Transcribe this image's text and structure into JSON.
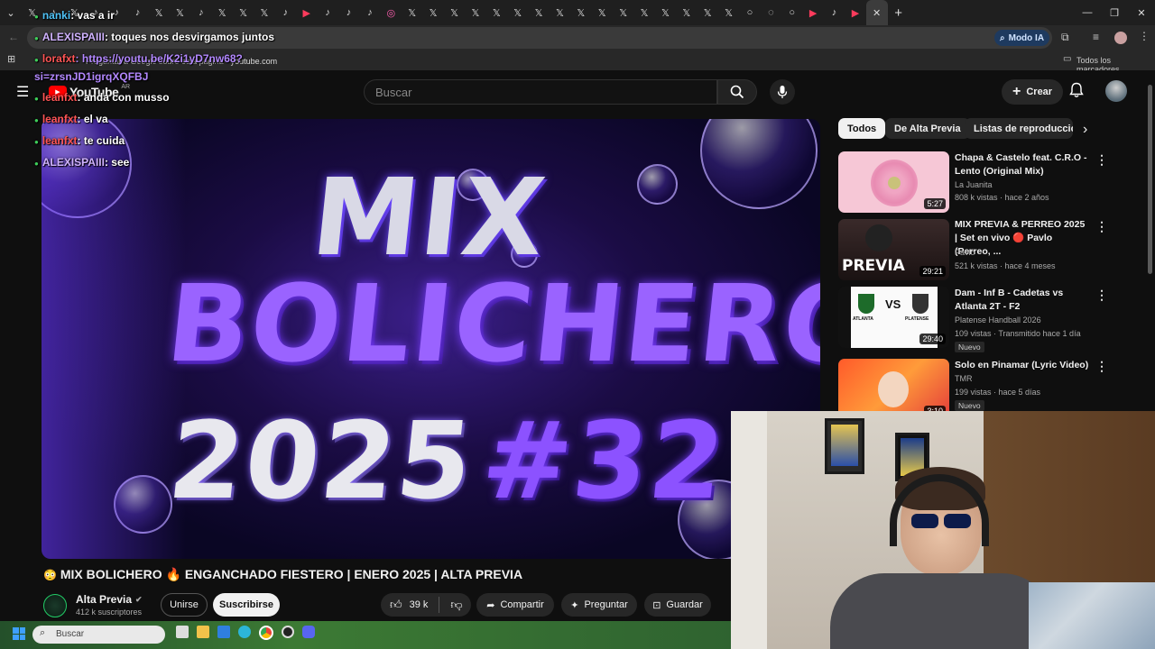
{
  "browser": {
    "tab_icons": [
      "𝕏",
      "♪",
      "𝕏",
      "♪",
      "♪",
      "♪",
      "𝕏",
      "𝕏",
      "♪",
      "𝕏",
      "𝕏",
      "𝕏",
      "♪",
      "▶",
      "♪",
      "♪",
      "♪",
      "◎",
      "𝕏",
      "𝕏",
      "𝕏",
      "𝕏",
      "𝕏",
      "𝕏",
      "𝕏",
      "𝕏",
      "𝕏",
      "𝕏",
      "𝕏",
      "𝕏",
      "𝕏",
      "𝕏",
      "𝕏",
      "𝕏",
      "○",
      "◌",
      "○",
      "▶",
      "♪",
      "▶"
    ],
    "new_tab": "+",
    "suggestion_text": "Preguntar a Google sobre esta página",
    "suggestion_domain": "youtube.com",
    "ai_mode": "Modo IA",
    "bookmarks_folder": "Todos los marcadores"
  },
  "youtube": {
    "logo": "YouTube",
    "logo_country": "AR",
    "search_placeholder": "Buscar",
    "create_label": "Crear",
    "video": {
      "title": "MIX BOLICHERO 🔥 ENGANCHADO FIESTERO | ENERO 2025 | ALTA PREVIA",
      "thumb_line1": "MIX",
      "thumb_line2": "BOLICHERO",
      "thumb_line3a": "2025",
      "thumb_line3b": "#32",
      "channel": "Alta Previa",
      "subscribers": "412 k suscriptores",
      "join": "Unirse",
      "subscribe": "Suscribirse",
      "likes": "39 k",
      "share": "Compartir",
      "ask": "Preguntar",
      "save": "Guardar"
    },
    "chips": [
      "Todos",
      "De Alta Previa",
      "Listas de reproducción"
    ],
    "recommendations": [
      {
        "title": "Chapa & Castelo feat. C.R.O - Lento (Original Mix)",
        "channel": "La Juanita",
        "meta": "808 k vistas · hace 2 años",
        "duration": "5:27",
        "badge": ""
      },
      {
        "title": "MIX PREVIA & PERREO 2025 | Set en vivo 🔴 Pavlo (Perreo, ...",
        "channel": "Pavlo",
        "meta": "521 k vistas · hace 4 meses",
        "duration": "29:21",
        "badge": "",
        "thumb_text": "PREVIA"
      },
      {
        "title": "Dam - Inf B - Cadetas vs Atlanta 2T - F2",
        "channel": "Platense Handball 2026",
        "meta": "109 vistas · Transmitido hace 1 día",
        "duration": "29:40",
        "badge": "Nuevo",
        "thumb_text": "VS",
        "team1": "ATLANTA",
        "team2": "PLATENSE"
      },
      {
        "title": "Solo en Pinamar (Lyric Video)",
        "channel": "TMR",
        "meta": "199 vistas · hace 5 días",
        "duration": "3:10",
        "badge": "Nuevo"
      }
    ]
  },
  "chat": [
    {
      "user": "nanki",
      "text": ": vas a ir",
      "color": "#4fc3f7"
    },
    {
      "user": "ALEXISPAIII",
      "text": ": toques nos desvirgamos juntos",
      "color": "#d0b3ff"
    },
    {
      "user": "lorafxt",
      "text": ": https://youtu.be/K2i1yD7nw68?",
      "color": "#ff5555"
    },
    {
      "user": "",
      "text": "si=zrsnJD1igrqXQFBJ",
      "color": "#b388ff"
    },
    {
      "user": "leanfxt",
      "text": ": anda con musso",
      "color": "#ff5555"
    },
    {
      "user": "leanfxt",
      "text": ": el va",
      "color": "#ff5555"
    },
    {
      "user": "leanfxt",
      "text": ": te cuida",
      "color": "#ff5555"
    },
    {
      "user": "ALEXISPAIII",
      "text": ": see",
      "color": "#d0b3ff"
    }
  ],
  "taskbar": {
    "search_placeholder": "Buscar"
  }
}
